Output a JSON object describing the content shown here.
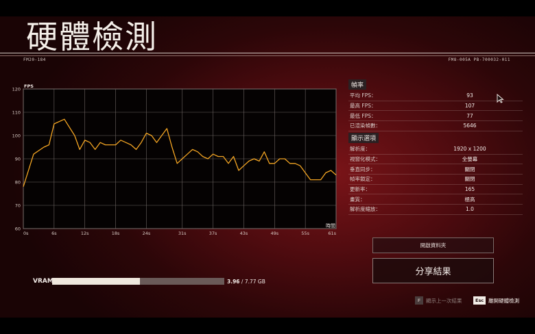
{
  "header": {
    "title": "硬體檢測",
    "code_left": "FM20-184",
    "code_right": "FM8-005A PB-700032-011"
  },
  "chart_data": {
    "type": "line",
    "title": "",
    "ylabel": "FPS",
    "xlabel": "時間",
    "ylim": [
      60,
      120
    ],
    "y_ticks": [
      "120",
      "110",
      "100",
      "90",
      "80",
      "70",
      "60"
    ],
    "x_ticks": [
      "0s",
      "6s",
      "12s",
      "18s",
      "24s",
      "31s",
      "37s",
      "43s",
      "49s",
      "55s",
      "61s"
    ],
    "xlim": [
      0,
      61
    ],
    "grid": true,
    "line_color": "#f5a623",
    "x": [
      0,
      2,
      4,
      5,
      6,
      8,
      10,
      11,
      12,
      13,
      14,
      15,
      16,
      17,
      18,
      19,
      20,
      21,
      22,
      23,
      24,
      25,
      26,
      27,
      28,
      29,
      30,
      31,
      32,
      33,
      34,
      35,
      36,
      37,
      38,
      39,
      40,
      41,
      42,
      43,
      44,
      45,
      46,
      47,
      48,
      49,
      50,
      51,
      52,
      53,
      54,
      55,
      56,
      57,
      58,
      59,
      60,
      61
    ],
    "y": [
      78,
      92,
      95,
      96,
      105,
      107,
      100,
      94,
      98,
      97,
      94,
      97,
      96,
      96,
      96,
      98,
      97,
      96,
      94,
      97,
      101,
      100,
      97,
      100,
      103,
      95,
      88,
      90,
      92,
      94,
      93,
      91,
      90,
      92,
      91,
      91,
      88,
      91,
      85,
      87,
      89,
      90,
      89,
      93,
      88,
      88,
      90,
      90,
      88,
      88,
      87,
      84,
      81,
      81,
      81,
      84,
      85,
      83
    ]
  },
  "frame_rate": {
    "heading": "幀率",
    "rows": [
      {
        "label": "平均 FPS：",
        "value": "93"
      },
      {
        "label": "最高 FPS：",
        "value": "107"
      },
      {
        "label": "最低 FPS：",
        "value": "77"
      },
      {
        "label": "已渲染幀數：",
        "value": "5646"
      }
    ]
  },
  "display_options": {
    "heading": "顯示選項",
    "rows": [
      {
        "label": "解析度：",
        "value": "1920 x 1200"
      },
      {
        "label": "視窗化模式：",
        "value": "全螢幕"
      },
      {
        "label": "垂直同步：",
        "value": "關閉"
      },
      {
        "label": "幀率鎖定：",
        "value": "關閉"
      },
      {
        "label": "更新率：",
        "value": "165"
      },
      {
        "label": "畫質：",
        "value": "極高"
      },
      {
        "label": "解析度縮放：",
        "value": "1.0"
      }
    ]
  },
  "buttons": {
    "open_folder": "開啟資料夾",
    "share_results": "分享結果"
  },
  "vram": {
    "label": "VRAM",
    "used": "3.96",
    "total": "7.77 GB",
    "fraction": 0.51
  },
  "footer": {
    "prev_key": "F",
    "prev_label": "顯示上一次結果",
    "leave_key": "Esc",
    "leave_label": "離開硬體檢測"
  }
}
